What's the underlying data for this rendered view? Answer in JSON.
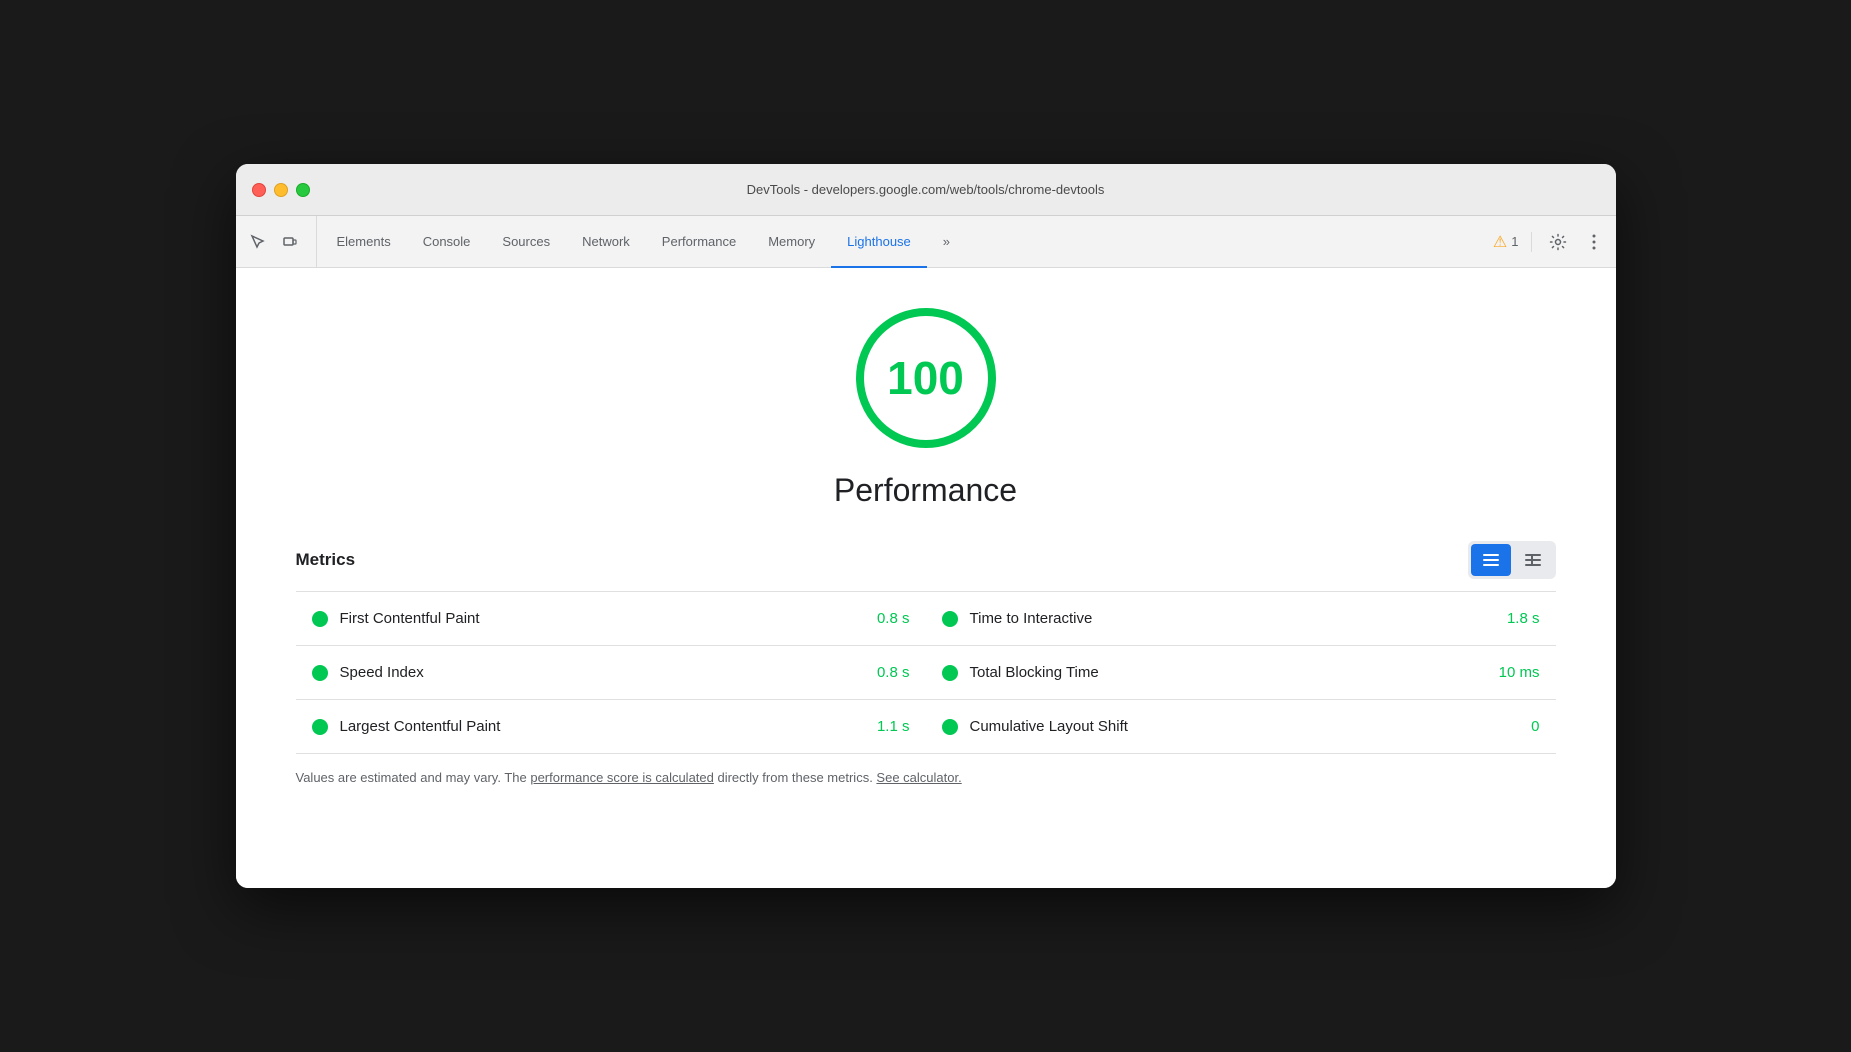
{
  "window": {
    "title": "DevTools - developers.google.com/web/tools/chrome-devtools"
  },
  "toolbar": {
    "inspect_icon": "⌖",
    "device_icon": "▭",
    "tabs": [
      {
        "id": "elements",
        "label": "Elements",
        "active": false
      },
      {
        "id": "console",
        "label": "Console",
        "active": false
      },
      {
        "id": "sources",
        "label": "Sources",
        "active": false
      },
      {
        "id": "network",
        "label": "Network",
        "active": false
      },
      {
        "id": "performance",
        "label": "Performance",
        "active": false
      },
      {
        "id": "memory",
        "label": "Memory",
        "active": false
      },
      {
        "id": "lighthouse",
        "label": "Lighthouse",
        "active": true
      }
    ],
    "more_tabs_label": "»",
    "warning_count": "1",
    "settings_label": "⚙",
    "more_label": "⋮"
  },
  "main": {
    "score": "100",
    "score_label": "Performance",
    "metrics_title": "Metrics",
    "metrics": [
      {
        "left": {
          "name": "First Contentful Paint",
          "value": "0.8 s"
        },
        "right": {
          "name": "Time to Interactive",
          "value": "1.8 s"
        }
      },
      {
        "left": {
          "name": "Speed Index",
          "value": "0.8 s"
        },
        "right": {
          "name": "Total Blocking Time",
          "value": "10 ms"
        }
      },
      {
        "left": {
          "name": "Largest Contentful Paint",
          "value": "1.1 s"
        },
        "right": {
          "name": "Cumulative Layout Shift",
          "value": "0"
        }
      }
    ],
    "footer_text_before_link1": "Values are estimated and may vary. The ",
    "footer_link1": "performance score is calculated",
    "footer_text_after_link1": " directly from these metrics. ",
    "footer_link2": "See calculator.",
    "view_toggle": {
      "list_icon": "≡",
      "grid_icon": "≣"
    }
  }
}
